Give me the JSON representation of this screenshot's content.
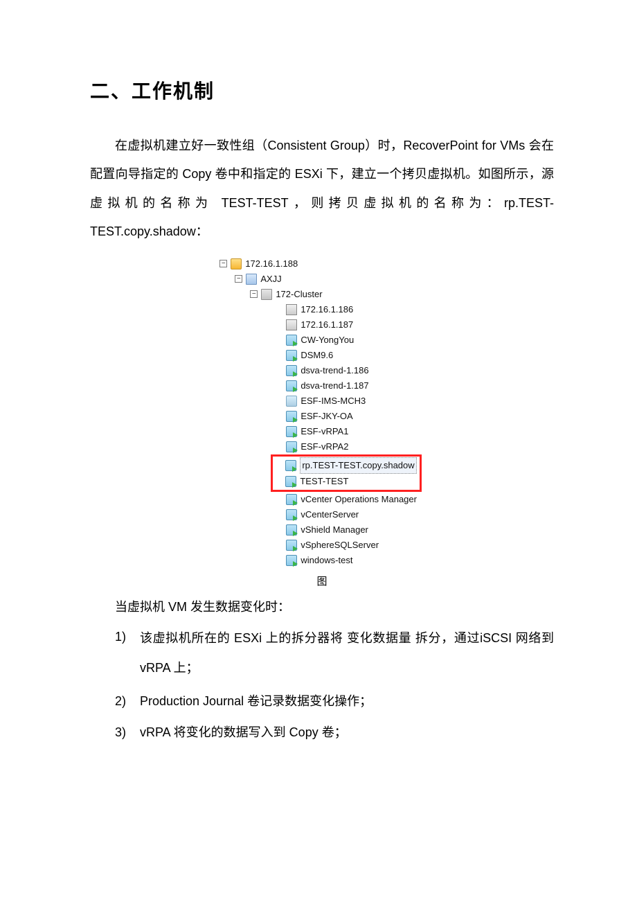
{
  "title": "二、工作机制",
  "paragraph1": "在虚拟机建立好一致性组（Consistent Group）时，RecoverPoint for VMs 会在配置向导指定的 Copy 卷中和指定的 ESXi 下，建立一个拷贝虚拟机。如图所示，源虚拟机的名称为 TEST-TEST，则拷贝虚拟机的名称为：rp.TEST-TEST.copy.shadow：",
  "tree": {
    "root": "172.16.1.188",
    "datacenter": "AXJJ",
    "cluster": "172-Cluster",
    "hosts": [
      "172.16.1.186",
      "172.16.1.187"
    ],
    "vms_before": [
      "CW-YongYou",
      "DSM9.6",
      "dsva-trend-1.186",
      "dsva-trend-1.187",
      "ESF-IMS-MCH3",
      "ESF-JKY-OA",
      "ESF-vRPA1",
      "ESF-vRPA2"
    ],
    "vms_before_off_indexes": [
      4
    ],
    "highlight": [
      "rp.TEST-TEST.copy.shadow",
      "TEST-TEST"
    ],
    "vms_after": [
      "vCenter Operations Manager",
      "vCenterServer",
      "vShield Manager",
      "vSphereSQLServer",
      "windows-test"
    ]
  },
  "figure_caption": "图",
  "paragraph2": "当虚拟机 VM 发生数据变化时：",
  "list": [
    {
      "num": "1)",
      "text": "该虚拟机所在的 ESXi 上的拆分器将  变化数据量  拆分，通过iSCSI 网络到 vRPA 上；"
    },
    {
      "num": "2)",
      "text": "Production Journal 卷记录数据变化操作；"
    },
    {
      "num": "3)",
      "text": "vRPA 将变化的数据写入到 Copy 卷；"
    }
  ]
}
